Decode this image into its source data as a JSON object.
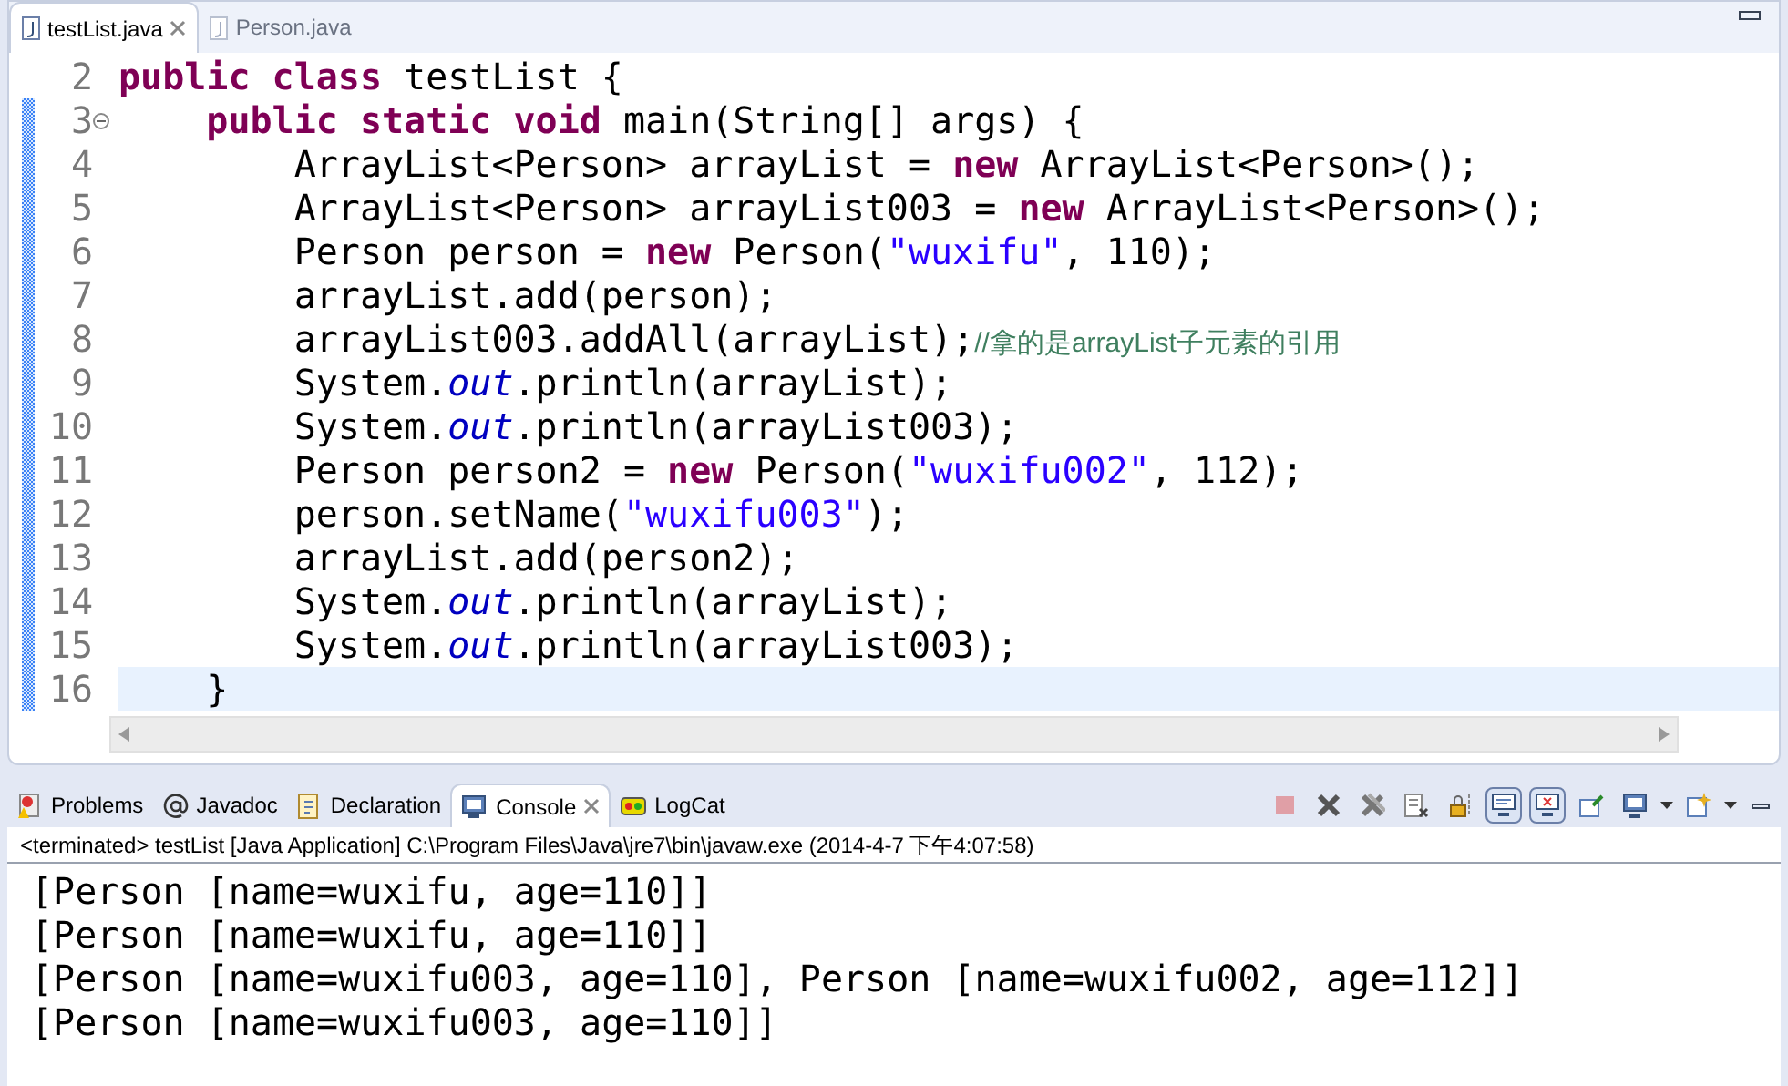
{
  "editor": {
    "tabs": [
      {
        "label": "testList.java",
        "selected": true
      },
      {
        "label": "Person.java",
        "selected": false
      }
    ],
    "lines": [
      {
        "number": "2",
        "changed": false,
        "current": false,
        "folding": false,
        "tokens": [
          {
            "text": "public class",
            "kind": "keyword"
          },
          {
            "text": " testList {",
            "kind": "plain"
          }
        ]
      },
      {
        "number": "3",
        "changed": true,
        "current": false,
        "folding": true,
        "tokens": [
          {
            "text": "    public static void",
            "kind": "keyword"
          },
          {
            "text": " main(String[] args) {",
            "kind": "plain"
          }
        ]
      },
      {
        "number": "4",
        "changed": true,
        "current": false,
        "folding": false,
        "tokens": [
          {
            "text": "        ArrayList<Person> arrayList = ",
            "kind": "plain"
          },
          {
            "text": "new",
            "kind": "keyword"
          },
          {
            "text": " ArrayList<Person>();",
            "kind": "plain"
          }
        ]
      },
      {
        "number": "5",
        "changed": true,
        "current": false,
        "folding": false,
        "tokens": [
          {
            "text": "        ArrayList<Person> arrayList003 = ",
            "kind": "plain"
          },
          {
            "text": "new",
            "kind": "keyword"
          },
          {
            "text": " ArrayList<Person>();",
            "kind": "plain"
          }
        ]
      },
      {
        "number": "6",
        "changed": true,
        "current": false,
        "folding": false,
        "tokens": [
          {
            "text": "        Person person = ",
            "kind": "plain"
          },
          {
            "text": "new",
            "kind": "keyword"
          },
          {
            "text": " Person(",
            "kind": "plain"
          },
          {
            "text": "\"wuxifu\"",
            "kind": "string"
          },
          {
            "text": ", 110);",
            "kind": "plain"
          }
        ]
      },
      {
        "number": "7",
        "changed": true,
        "current": false,
        "folding": false,
        "tokens": [
          {
            "text": "        arrayList.add(person);",
            "kind": "plain"
          }
        ]
      },
      {
        "number": "8",
        "changed": true,
        "current": false,
        "folding": false,
        "tokens": [
          {
            "text": "        arrayList003.addAll(arrayList);",
            "kind": "plain"
          },
          {
            "text": "//拿的是arrayList子元素的引用",
            "kind": "comment"
          }
        ]
      },
      {
        "number": "9",
        "changed": true,
        "current": false,
        "folding": false,
        "tokens": [
          {
            "text": "        System.",
            "kind": "plain"
          },
          {
            "text": "out",
            "kind": "field"
          },
          {
            "text": ".println(arrayList);",
            "kind": "plain"
          }
        ]
      },
      {
        "number": "10",
        "changed": true,
        "current": false,
        "folding": false,
        "tokens": [
          {
            "text": "        System.",
            "kind": "plain"
          },
          {
            "text": "out",
            "kind": "field"
          },
          {
            "text": ".println(arrayList003);",
            "kind": "plain"
          }
        ]
      },
      {
        "number": "11",
        "changed": true,
        "current": false,
        "folding": false,
        "tokens": [
          {
            "text": "        Person person2 = ",
            "kind": "plain"
          },
          {
            "text": "new",
            "kind": "keyword"
          },
          {
            "text": " Person(",
            "kind": "plain"
          },
          {
            "text": "\"wuxifu002\"",
            "kind": "string"
          },
          {
            "text": ", 112);",
            "kind": "plain"
          }
        ]
      },
      {
        "number": "12",
        "changed": true,
        "current": false,
        "folding": false,
        "tokens": [
          {
            "text": "        person.setName(",
            "kind": "plain"
          },
          {
            "text": "\"wuxifu003\"",
            "kind": "string"
          },
          {
            "text": ");",
            "kind": "plain"
          }
        ]
      },
      {
        "number": "13",
        "changed": true,
        "current": false,
        "folding": false,
        "tokens": [
          {
            "text": "        arrayList.add(person2);",
            "kind": "plain"
          }
        ]
      },
      {
        "number": "14",
        "changed": true,
        "current": false,
        "folding": false,
        "tokens": [
          {
            "text": "        System.",
            "kind": "plain"
          },
          {
            "text": "out",
            "kind": "field"
          },
          {
            "text": ".println(arrayList);",
            "kind": "plain"
          }
        ]
      },
      {
        "number": "15",
        "changed": true,
        "current": false,
        "folding": false,
        "tokens": [
          {
            "text": "        System.",
            "kind": "plain"
          },
          {
            "text": "out",
            "kind": "field"
          },
          {
            "text": ".println(arrayList003);",
            "kind": "plain"
          }
        ]
      },
      {
        "number": "16",
        "changed": true,
        "current": true,
        "folding": false,
        "tokens": [
          {
            "text": "    }",
            "kind": "plain"
          }
        ]
      }
    ]
  },
  "bottom_panel": {
    "tabs": [
      {
        "label": "Problems",
        "kind": "problems",
        "selected": false
      },
      {
        "label": "Javadoc",
        "kind": "javadoc",
        "selected": false
      },
      {
        "label": "Declaration",
        "kind": "declaration",
        "selected": false
      },
      {
        "label": "Console",
        "kind": "console",
        "selected": true
      },
      {
        "label": "LogCat",
        "kind": "logcat",
        "selected": false
      }
    ],
    "toolbar": [
      {
        "kind": "terminate",
        "disabled": true,
        "pressed": false
      },
      {
        "kind": "remove",
        "disabled": false,
        "pressed": false
      },
      {
        "kind": "remove-all",
        "disabled": false,
        "pressed": false
      },
      {
        "kind": "clear",
        "disabled": false,
        "pressed": false
      },
      {
        "kind": "lock",
        "disabled": false,
        "pressed": false
      },
      {
        "kind": "show-out",
        "disabled": false,
        "pressed": true
      },
      {
        "kind": "show-err",
        "disabled": false,
        "pressed": true
      },
      {
        "kind": "pin",
        "disabled": false,
        "pressed": false
      },
      {
        "kind": "display",
        "disabled": false,
        "pressed": false
      },
      {
        "kind": "new-console",
        "disabled": false,
        "pressed": false
      }
    ],
    "process": "<terminated> testList [Java Application] C:\\Program Files\\Java\\jre7\\bin\\javaw.exe (2014-4-7 下午4:07:58)",
    "output": [
      "[Person [name=wuxifu, age=110]]",
      "[Person [name=wuxifu, age=110]]",
      "[Person [name=wuxifu003, age=110], Person [name=wuxifu002, age=112]]",
      "[Person [name=wuxifu003, age=110]]"
    ]
  }
}
